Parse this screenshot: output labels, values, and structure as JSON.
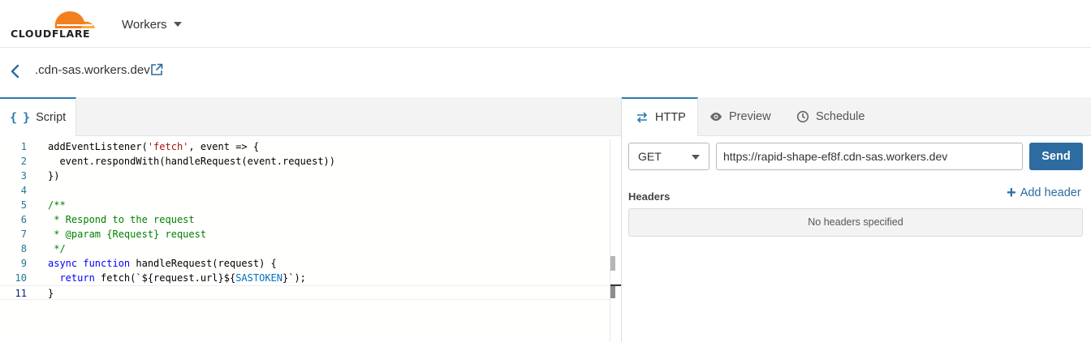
{
  "topbar": {
    "logo_text": "CLOUDFLARE",
    "product": "Workers"
  },
  "breadcrumb": {
    "domain": ".cdn-sas.workers.dev"
  },
  "editor": {
    "tab_label": "Script",
    "lines": [
      {
        "n": "1",
        "tokens": [
          [
            "addEventListener(",
            ""
          ],
          [
            "'fetch'",
            "str"
          ],
          [
            ", event => {",
            ""
          ]
        ]
      },
      {
        "n": "2",
        "tokens": [
          [
            "  event.respondWith(handleRequest(event.request))",
            ""
          ]
        ]
      },
      {
        "n": "3",
        "tokens": [
          [
            "})",
            ""
          ]
        ]
      },
      {
        "n": "4",
        "tokens": []
      },
      {
        "n": "5",
        "tokens": [
          [
            "/**",
            "com"
          ]
        ]
      },
      {
        "n": "6",
        "tokens": [
          [
            " * Respond to the request",
            "com"
          ]
        ]
      },
      {
        "n": "7",
        "tokens": [
          [
            " * @param {Request} request",
            "com"
          ]
        ]
      },
      {
        "n": "8",
        "tokens": [
          [
            " */",
            "com"
          ]
        ]
      },
      {
        "n": "9",
        "tokens": [
          [
            "async",
            "kw"
          ],
          [
            " ",
            ""
          ],
          [
            "function",
            "kw"
          ],
          [
            " handleRequest(request) {",
            ""
          ]
        ]
      },
      {
        "n": "10",
        "tokens": [
          [
            "  ",
            ""
          ],
          [
            "return",
            "kw"
          ],
          [
            " fetch(`${request.url}${",
            ""
          ],
          [
            "SASTOKEN",
            "var"
          ],
          [
            "}`);",
            ""
          ]
        ]
      },
      {
        "n": "11",
        "tokens": [
          [
            "}",
            ""
          ]
        ]
      }
    ],
    "current_line": 11
  },
  "right_panel": {
    "tabs": [
      {
        "label": "HTTP",
        "icon": "arrows-exchange-icon",
        "active": true
      },
      {
        "label": "Preview",
        "icon": "eye-icon",
        "active": false
      },
      {
        "label": "Schedule",
        "icon": "clock-icon",
        "active": false
      }
    ],
    "method": "GET",
    "url": "https://rapid-shape-ef8f.cdn-sas.workers.dev",
    "send_label": "Send",
    "headers_label": "Headers",
    "add_header_label": "Add header",
    "no_headers_text": "No headers specified"
  },
  "colors": {
    "accent": "#2c7cb0",
    "button": "#2c6ca0",
    "logo_orange": "#f38020"
  }
}
